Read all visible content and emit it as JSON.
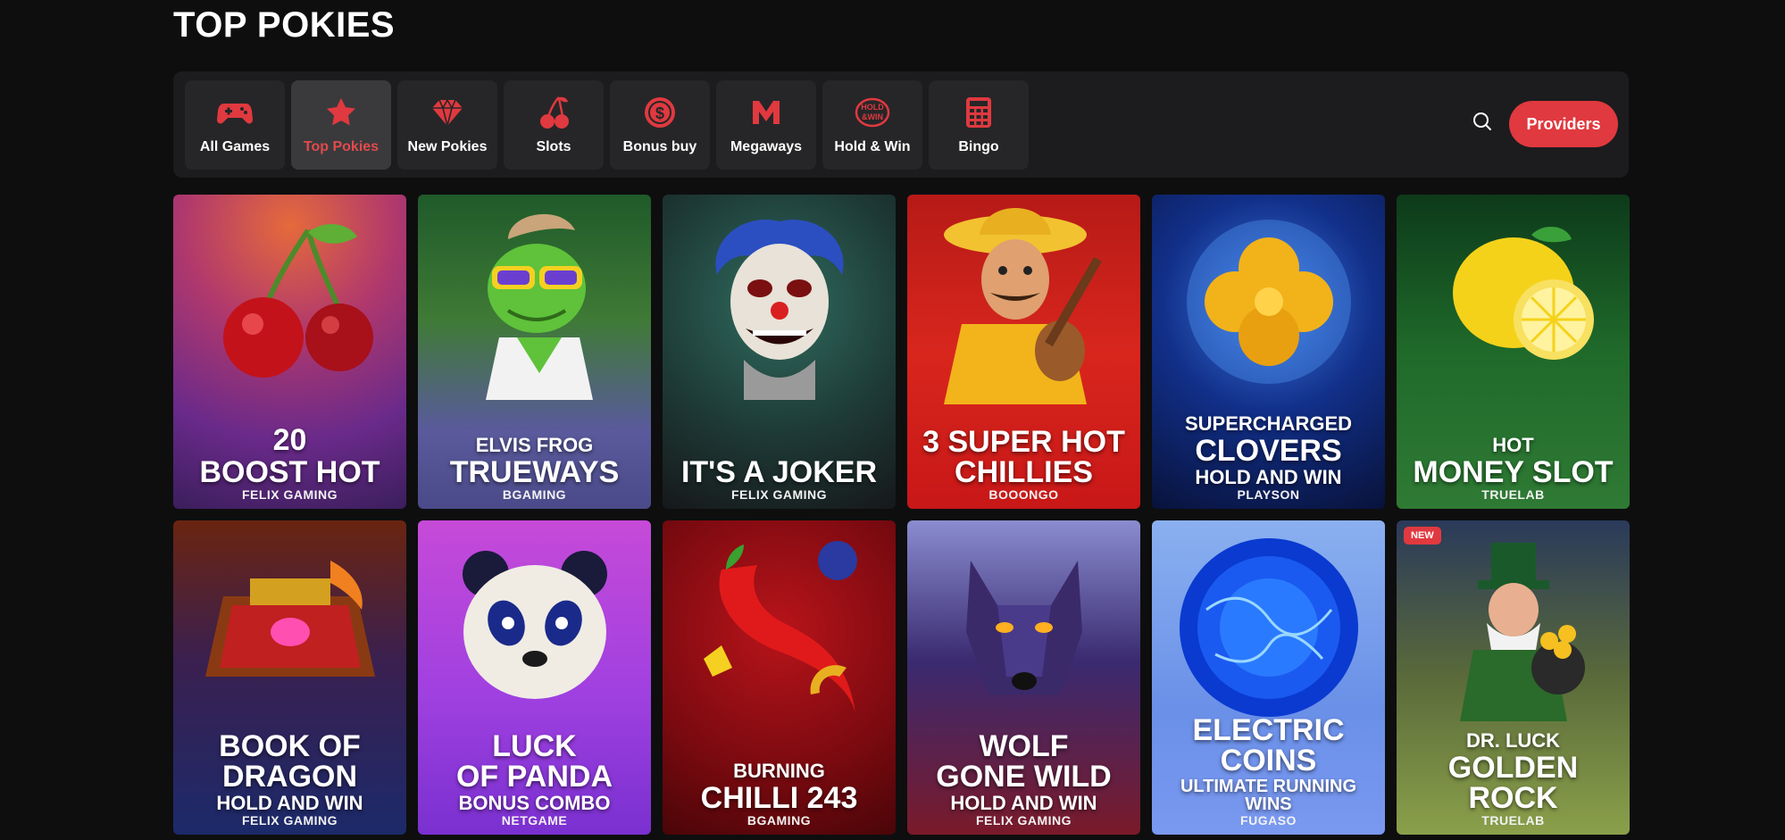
{
  "page": {
    "title": "TOP POKIES"
  },
  "colors": {
    "accent": "#e0393f",
    "active_tab_label": "#e14a4c",
    "background": "#0e0e0f"
  },
  "tabs": [
    {
      "label": "All Games",
      "icon": "gamepad-icon"
    },
    {
      "label": "Top Pokies",
      "icon": "star-icon",
      "active": true
    },
    {
      "label": "New Pokies",
      "icon": "diamond-icon"
    },
    {
      "label": "Slots",
      "icon": "cherry-icon"
    },
    {
      "label": "Bonus buy",
      "icon": "coin-icon"
    },
    {
      "label": "Megaways",
      "icon": "megaways-icon"
    },
    {
      "label": "Hold & Win",
      "icon": "hold-and-win-icon"
    },
    {
      "label": "Bingo",
      "icon": "bingo-icon"
    }
  ],
  "toolbar": {
    "search_icon": "search-icon",
    "providers_label": "Providers"
  },
  "games": [
    {
      "l1": "20",
      "l2": "BOOST HOT",
      "l3": "",
      "provider": "FELIX GAMING"
    },
    {
      "l1": "ELVIS FROG",
      "l2": "TRUEWAYS",
      "l3": "",
      "provider": "BGAMING"
    },
    {
      "l1": "",
      "l2": "IT'S A JOKER",
      "l3": "",
      "provider": "FELIX GAMING"
    },
    {
      "l1": "3 SUPER HOT",
      "l2": "CHILLIES",
      "l3": "",
      "provider": "BOOONGO"
    },
    {
      "l1": "SUPERCHARGED",
      "l2": "CLOVERS",
      "l3": "HOLD AND WIN",
      "provider": "PLAYSON"
    },
    {
      "l1": "HOT",
      "l2": "MONEY SLOT",
      "l3": "",
      "provider": "TRUELAB"
    },
    {
      "l1": "BOOK OF",
      "l2": "DRAGON",
      "l3": "HOLD AND WIN",
      "provider": "FELIX GAMING"
    },
    {
      "l1": "LUCK",
      "l2": "OF PANDA",
      "l3": "BONUS COMBO",
      "provider": "NETGAME"
    },
    {
      "l1": "BURNING",
      "l2": "CHILLI 243",
      "l3": "",
      "provider": "BGAMING"
    },
    {
      "l1": "WOLF",
      "l2": "GONE WILD",
      "l3": "HOLD AND WIN",
      "provider": "FELIX GAMING"
    },
    {
      "l1": "ELECTRIC",
      "l2": "COINS",
      "l3": "ULTIMATE RUNNING WINS",
      "provider": "FUGASO"
    },
    {
      "l1": "DR. LUCK",
      "l2": "GOLDEN",
      "l3": "ROCK",
      "provider": "TRUELAB",
      "badge": "NEW"
    }
  ]
}
